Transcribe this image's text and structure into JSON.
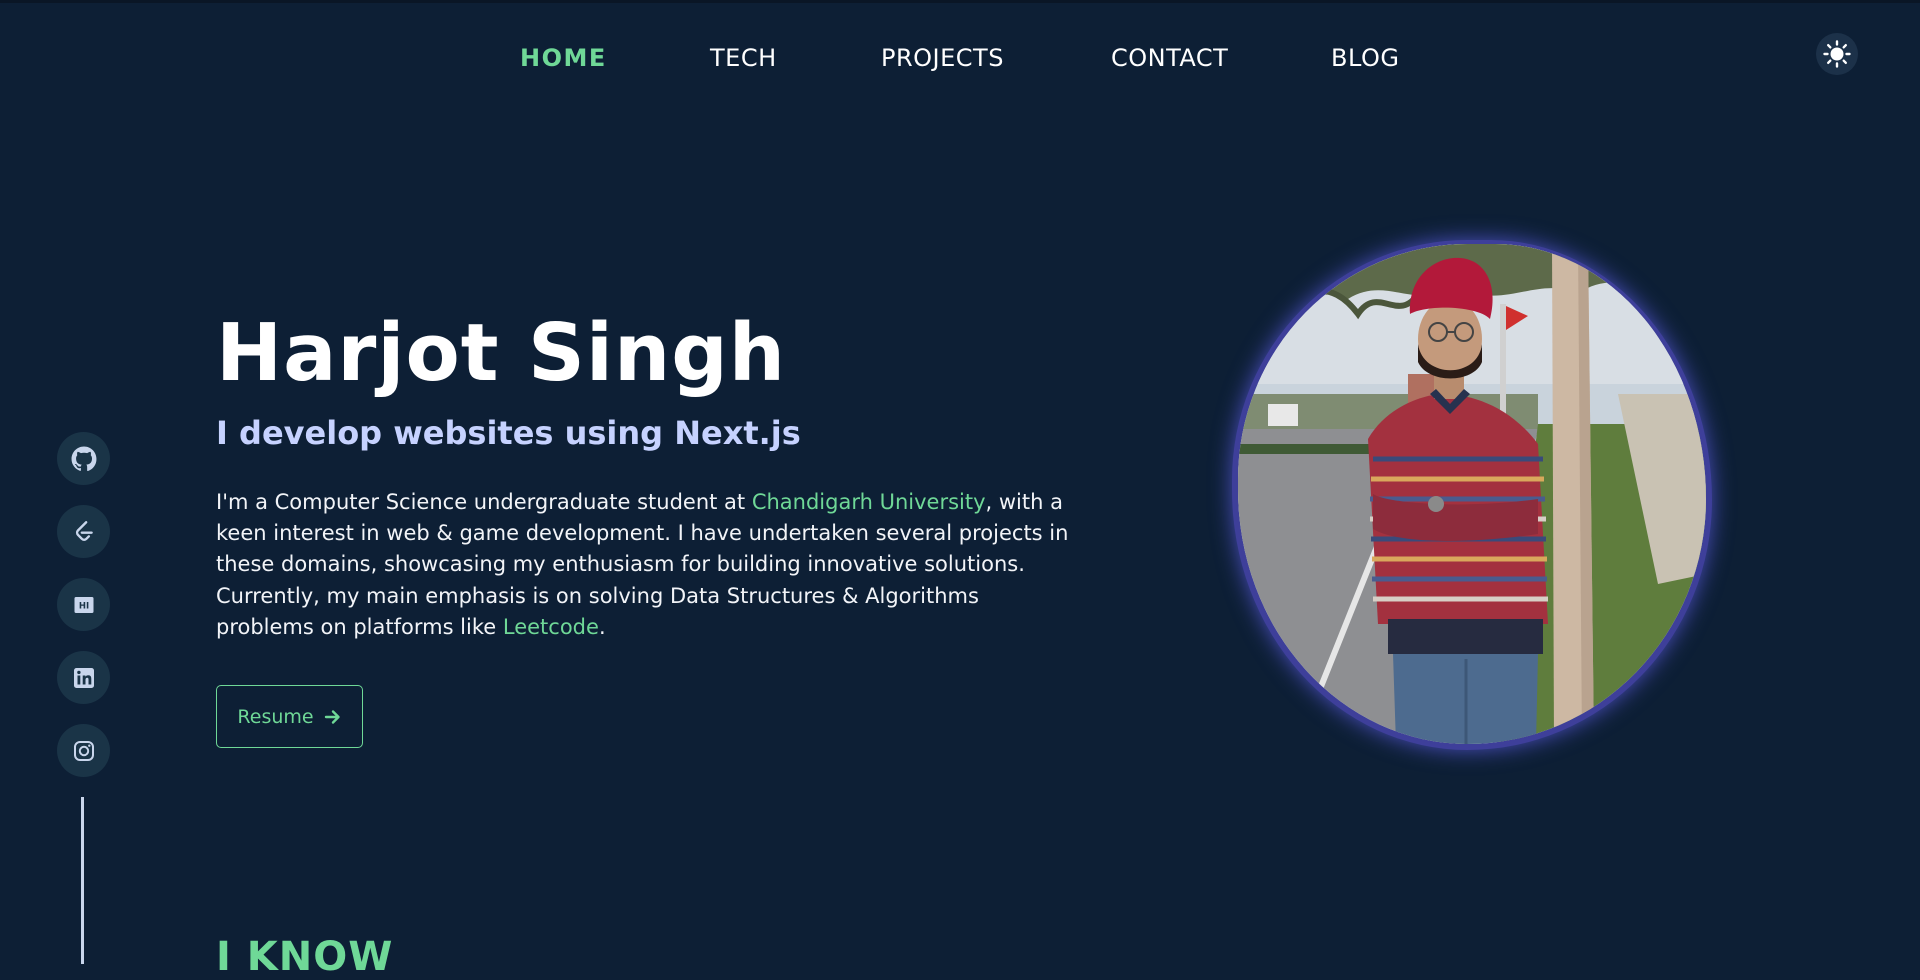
{
  "nav": {
    "links": [
      {
        "label": "HOME",
        "active": true
      },
      {
        "label": "TECH",
        "active": false
      },
      {
        "label": "PROJECTS",
        "active": false
      },
      {
        "label": "CONTACT",
        "active": false
      },
      {
        "label": "BLOG",
        "active": false
      }
    ],
    "theme_toggle_icon": "sun-icon"
  },
  "social": [
    "github-icon",
    "leetcode-icon",
    "hashnode-icon",
    "linkedin-icon",
    "instagram-icon"
  ],
  "hero": {
    "name": "Harjot Singh",
    "tagline": {
      "prefix": "I ",
      "bold": "develop",
      "suffix": " websites using Next.js"
    },
    "description": {
      "part1": "I'm a Computer Science undergraduate student at ",
      "link1": "Chandigarh University",
      "part2": ", with a keen interest in web & game development. I have undertaken several projects in these domains, showcasing my enthusiasm for building innovative solutions. Currently, my main emphasis is on solving Data Structures & Algorithms problems on platforms like ",
      "link2": "Leetcode",
      "part3": "."
    },
    "resume_label": "Resume"
  },
  "section": {
    "title": "I KNOW"
  },
  "colors": {
    "background": "#0d1f35",
    "accent": "#6fd897",
    "tagline": "#c6d2ff",
    "photo_border": "#3e3f9a"
  }
}
